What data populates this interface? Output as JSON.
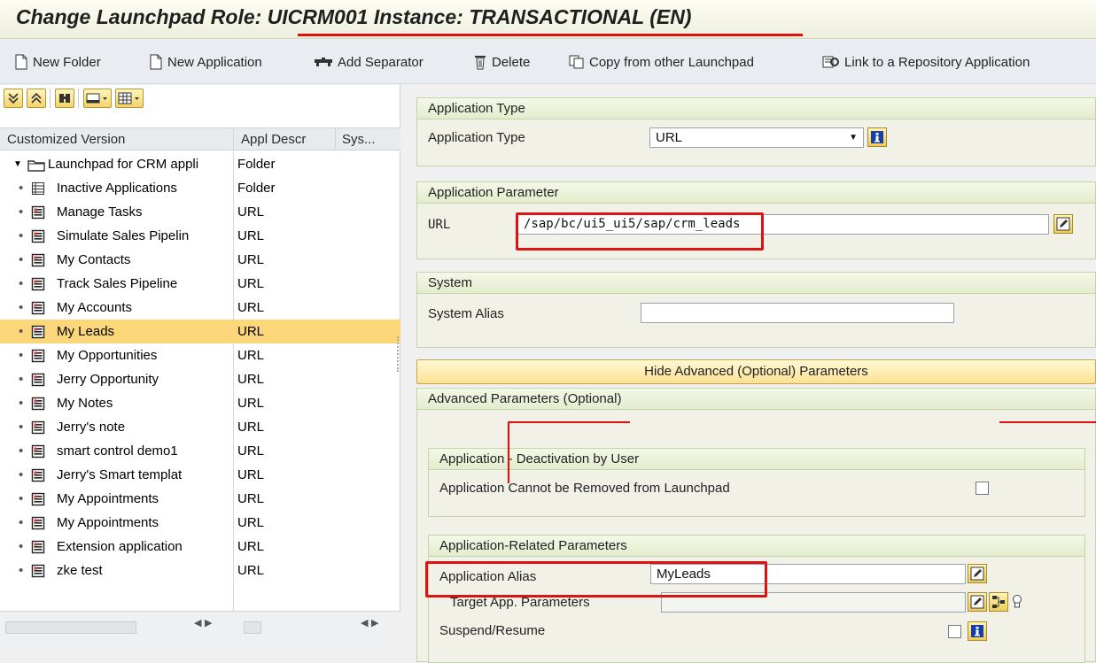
{
  "title": "Change Launchpad Role: UICRM001 Instance: TRANSACTIONAL (EN)",
  "toolbar": {
    "new_folder": "New Folder",
    "new_application": "New Application",
    "add_separator": "Add Separator",
    "delete": "Delete",
    "copy": "Copy from other Launchpad",
    "link": "Link to a Repository Application"
  },
  "tree": {
    "columns": [
      "Customized Version",
      "Appl Descr",
      "Sys..."
    ],
    "root": {
      "name": "Launchpad for CRM appli",
      "type": "Folder"
    },
    "items": [
      {
        "name": "Inactive Applications",
        "type": "Folder"
      },
      {
        "name": "Manage Tasks",
        "type": "URL"
      },
      {
        "name": "Simulate Sales Pipelin",
        "type": "URL"
      },
      {
        "name": "My Contacts",
        "type": "URL"
      },
      {
        "name": "Track Sales Pipeline",
        "type": "URL"
      },
      {
        "name": "My Accounts",
        "type": "URL"
      },
      {
        "name": "My Leads",
        "type": "URL",
        "selected": true
      },
      {
        "name": "My Opportunities",
        "type": "URL"
      },
      {
        "name": "Jerry Opportunity",
        "type": "URL"
      },
      {
        "name": "My Notes",
        "type": "URL"
      },
      {
        "name": "Jerry's note",
        "type": "URL"
      },
      {
        "name": "smart control demo1",
        "type": "URL"
      },
      {
        "name": "Jerry's Smart templat",
        "type": "URL"
      },
      {
        "name": "My Appointments",
        "type": "URL"
      },
      {
        "name": "My Appointments",
        "type": "URL"
      },
      {
        "name": "Extension application",
        "type": "URL"
      },
      {
        "name": "zke test",
        "type": "URL"
      }
    ]
  },
  "form": {
    "app_type_group": "Application Type",
    "app_type_label": "Application Type",
    "app_type_value": "URL",
    "app_param_group": "Application Parameter",
    "url_label": "URL",
    "url_value": "/sap/bc/ui5_ui5/sap/crm_leads",
    "system_group": "System",
    "system_alias_label": "System Alias",
    "system_alias_value": "",
    "hide_advanced": "Hide Advanced (Optional) Parameters",
    "advanced_group": "Advanced Parameters (Optional)",
    "deactivation_group": "Application - Deactivation by User",
    "cannot_remove_label": "Application Cannot be Removed from Launchpad",
    "related_group": "Application-Related Parameters",
    "alias_label": "Application Alias",
    "alias_value": "MyLeads",
    "target_params_label": "Target App. Parameters",
    "target_params_value": "",
    "suspend_label": "Suspend/Resume"
  },
  "icons": [
    "new-folder-icon",
    "new-application-icon",
    "add-separator-icon",
    "delete-icon",
    "copy-icon",
    "link-icon",
    "expand-all-icon",
    "collapse-all-icon",
    "find-icon",
    "print-icon",
    "layout-icon",
    "folder-icon",
    "application-icon",
    "dropdown-arrow-icon",
    "info-icon",
    "edit-icon"
  ],
  "colors": {
    "highlight_red": "#e01010",
    "selection": "#fcd77a",
    "group_border": "#c2d6a4"
  }
}
